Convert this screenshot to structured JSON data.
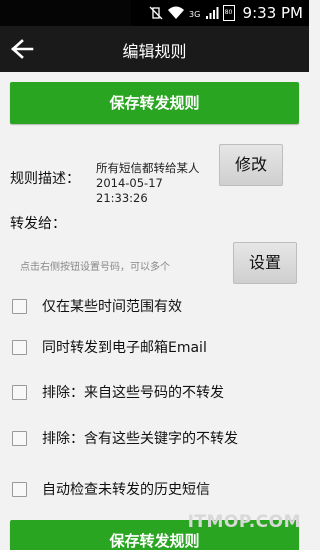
{
  "status_bar": {
    "time": "9:33 PM",
    "battery": "80",
    "network": "3G",
    "icons": [
      "vibrate-off-icon",
      "wifi-icon",
      "3g-signal-icon",
      "signal-bars-icon",
      "battery-icon"
    ]
  },
  "header": {
    "title": "编辑规则",
    "back_icon": "back-arrow-icon"
  },
  "save_button_label": "保存转发规则",
  "rule_description": {
    "label": "规则描述：",
    "text": "所有短信都转给某人2014-05-17 21:33:26",
    "edit_button": "修改"
  },
  "forward_to": {
    "label": "转发给：",
    "hint": "点击右侧按钮设置号码，可以多个",
    "set_button": "设置"
  },
  "options": [
    {
      "label": "仅在某些时间范围有效",
      "checked": false
    },
    {
      "label": "同时转发到电子邮箱Email",
      "checked": false
    },
    {
      "label": "排除：来自这些号码的不转发",
      "checked": false
    },
    {
      "label": "排除：含有这些关键字的不转发",
      "checked": false
    },
    {
      "label": "自动检查未转发的历史短信",
      "checked": false
    }
  ],
  "bottom_save_button_label": "保存转发规则",
  "watermark": "ITMOP.COM"
}
